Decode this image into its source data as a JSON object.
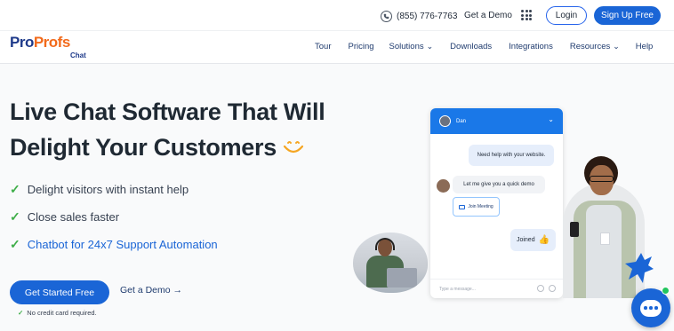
{
  "topbar": {
    "phone": "(855) 776-7763",
    "get_demo": "Get a Demo",
    "login": "Login",
    "signup": "Sign Up Free"
  },
  "logo": {
    "pro1": "Pro",
    "pro2": "Profs",
    "sub": "Chat"
  },
  "nav": {
    "items": [
      {
        "label": "Tour"
      },
      {
        "label": "Pricing"
      },
      {
        "label": "Solutions"
      },
      {
        "label": "Downloads"
      },
      {
        "label": "Integrations"
      },
      {
        "label": "Resources"
      },
      {
        "label": "Help"
      }
    ]
  },
  "hero": {
    "headline_line1": "Live Chat Software That Will",
    "headline_line2": "Delight Your Customers",
    "bullets": [
      "Delight visitors with instant help",
      "Close sales faster",
      "Chatbot for 24x7 Support Automation"
    ],
    "cta_primary": "Get Started Free",
    "cta_secondary": "Get a Demo →",
    "note": "No credit card required."
  },
  "chat_widget": {
    "agent_name": "Dan",
    "msg_visitor": "Need help with your website.",
    "msg_agent": "Let me give you a quick demo",
    "join_meeting": "Join Meeting",
    "msg_joined": "Joined",
    "input_placeholder": "Type a message..."
  },
  "colors": {
    "primary": "#1a65d6",
    "check_green": "#3fae49",
    "logo_navy": "#1e3a8a",
    "logo_orange": "#f26a1b",
    "smile_orange": "#f5a623"
  },
  "icons": {
    "phone": "phone-icon",
    "grid": "apps-grid-icon",
    "smile": "smile-icon",
    "check": "check-icon",
    "chat_bubble": "chat-bubble-icon"
  }
}
